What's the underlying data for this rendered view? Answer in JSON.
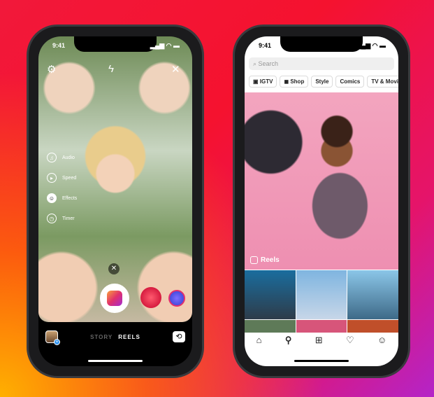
{
  "left_phone": {
    "status_time": "9:41",
    "tools": [
      {
        "label": "Audio",
        "icon": "music-note-icon"
      },
      {
        "label": "Speed",
        "icon": "speed-icon"
      },
      {
        "label": "Effects",
        "icon": "effects-icon"
      },
      {
        "label": "Timer",
        "icon": "timer-icon"
      }
    ],
    "modes": [
      "STORY",
      "REELS"
    ],
    "active_mode": "REELS"
  },
  "right_phone": {
    "status_time": "9:41",
    "search_placeholder": "Search",
    "chips": [
      "IGTV",
      "Shop",
      "Style",
      "Comics",
      "TV & Movie"
    ],
    "reels_label": "Reels"
  },
  "colors": {
    "accent": "#e1306c",
    "blue": "#3897f0"
  }
}
